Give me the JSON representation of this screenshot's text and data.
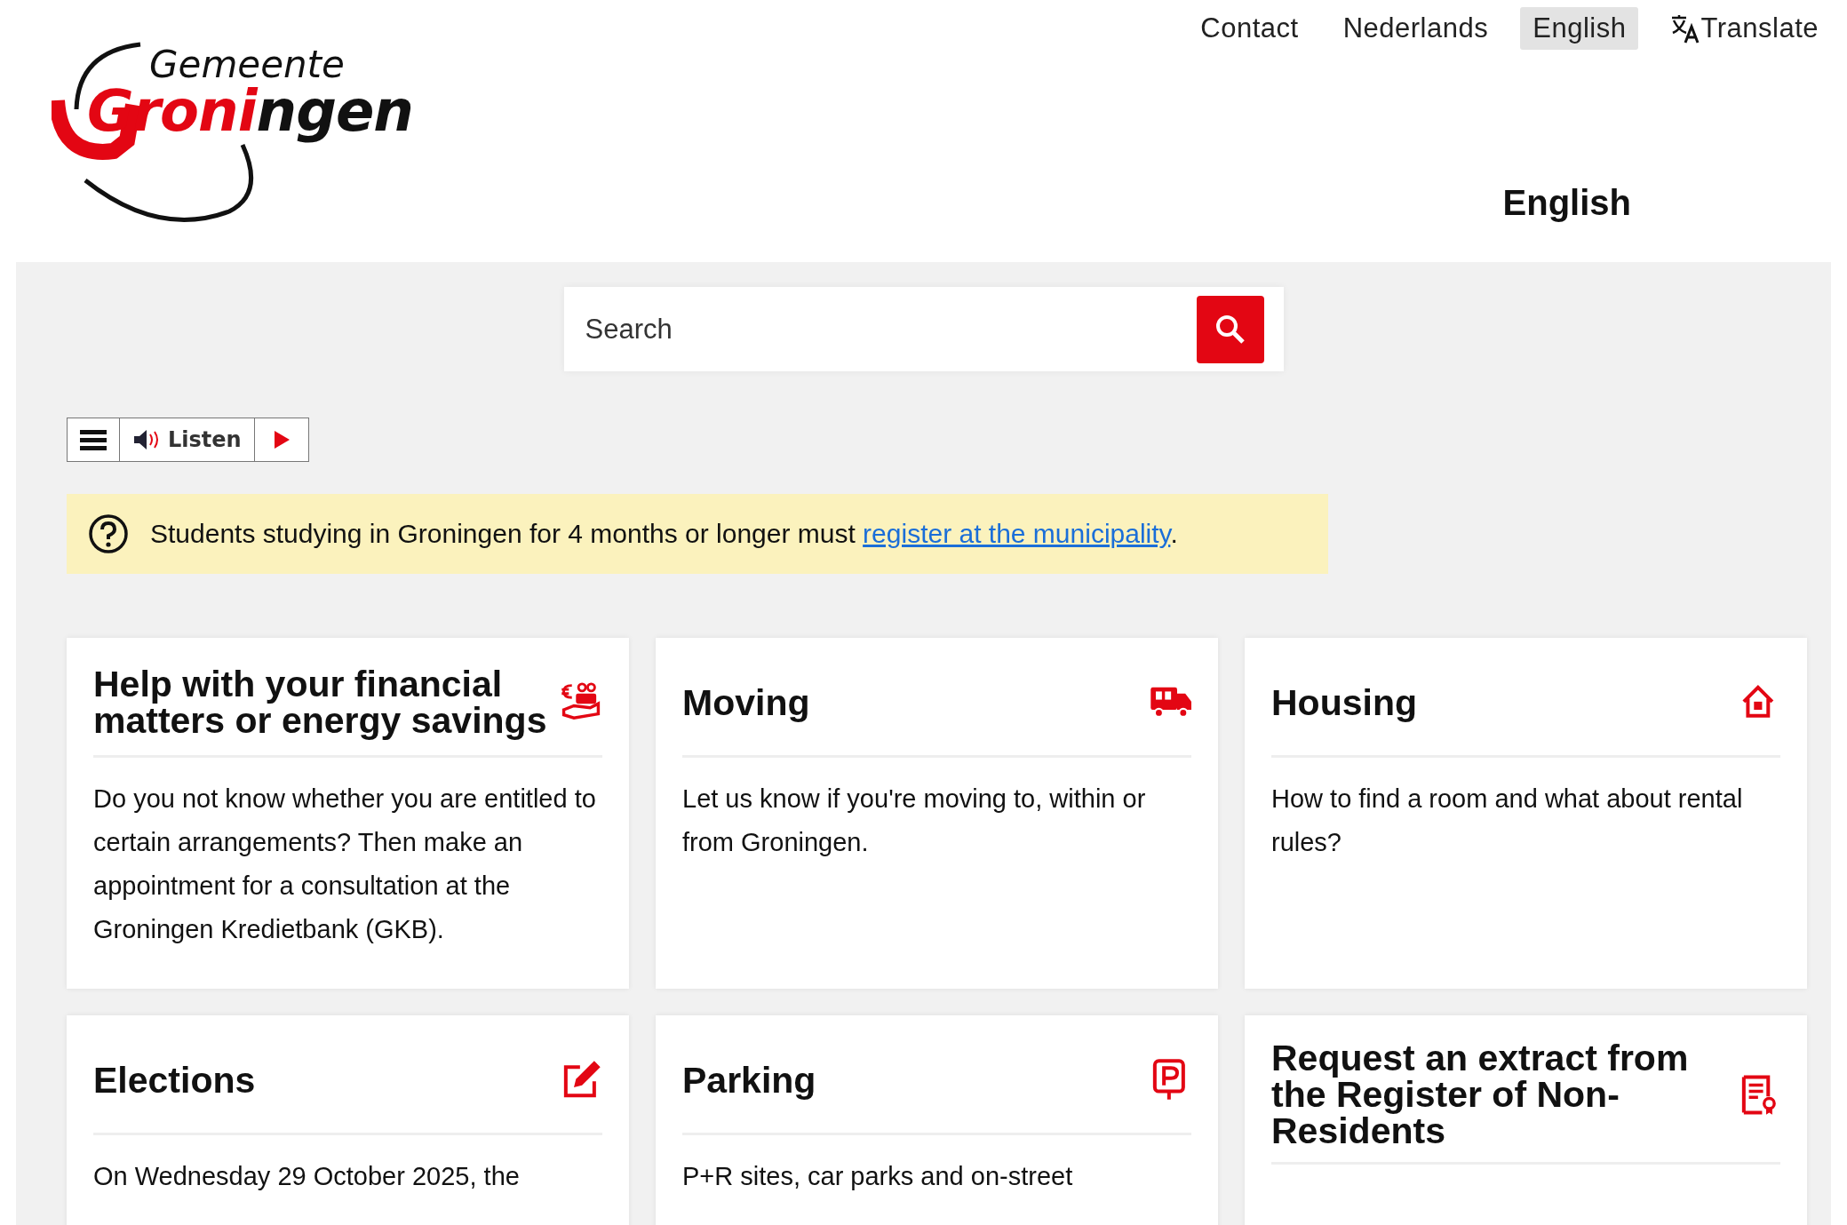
{
  "logo": {
    "top": "Gemeente",
    "name": "Groningen"
  },
  "top_nav": [
    {
      "label": "Contact",
      "selected": false,
      "kind": "link"
    },
    {
      "label": "Nederlands",
      "selected": false,
      "kind": "link"
    },
    {
      "label": "English",
      "selected": true,
      "kind": "link"
    },
    {
      "label": "Translate",
      "selected": false,
      "kind": "translate"
    }
  ],
  "language_heading": "English",
  "search": {
    "placeholder": "Search"
  },
  "read_aloud": {
    "label": "Listen"
  },
  "notice": {
    "text": "Students studying in Groningen for 4 months or longer must ",
    "link": "register at the municipality",
    "after": "."
  },
  "cards": [
    {
      "title": "Help with your financial matters or energy savings",
      "kind": "money",
      "text": "Do you not know whether you are entitled to certain arrangements? Then make an appointment for a consultation at the Groningen Kredietbank (GKB)."
    },
    {
      "title": "Moving",
      "kind": "truck",
      "text": "Let us know if you're moving to, within or from Groningen."
    },
    {
      "title": "Housing",
      "kind": "house",
      "text": "How to find a room and what about rental rules?"
    },
    {
      "title": "Elections",
      "kind": "pencil",
      "text": "On Wednesday 29 October 2025, the"
    },
    {
      "title": "Parking",
      "kind": "parking",
      "text": "P+R sites, car parks and on-street"
    },
    {
      "title": "Request an extract from the Register of Non-Residents",
      "kind": "document"
    }
  ]
}
